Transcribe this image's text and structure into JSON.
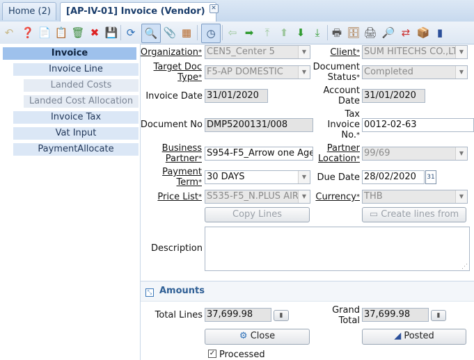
{
  "tabs": {
    "home": "Home (2)",
    "active": "[AP-IV-01] Invoice (Vendor)"
  },
  "toolbar": {
    "icons": [
      "undo-icon",
      "help-icon",
      "new-icon",
      "copy-icon",
      "delete-selection-icon",
      "delete-icon",
      "save-icon",
      "refresh-icon",
      "find-icon",
      "attachment-icon",
      "grid-toggle-icon",
      "history-icon",
      "parent-icon",
      "detail-icon",
      "first-record-icon",
      "previous-record-icon",
      "next-record-icon",
      "last-record-icon",
      "report-icon",
      "archive-icon",
      "print-icon",
      "zoom-across-icon",
      "requests-icon",
      "product-info-icon",
      "active-workflows-icon"
    ]
  },
  "tree": [
    {
      "label": "Invoice",
      "state": "selected"
    },
    {
      "label": "Invoice Line",
      "state": "normal"
    },
    {
      "label": "Landed Costs",
      "state": "disabled"
    },
    {
      "label": "Landed Cost Allocation",
      "state": "disabled"
    },
    {
      "label": "Invoice Tax",
      "state": "normal"
    },
    {
      "label": "Vat Input",
      "state": "normal"
    },
    {
      "label": "PaymentAllocate",
      "state": "normal"
    }
  ],
  "form": {
    "organization": {
      "label": "Organization",
      "value": "CEN5_Center 5"
    },
    "client": {
      "label": "Client",
      "value": "SUM HITECHS CO.,LTD"
    },
    "target_doc_type": {
      "label1": "Target Doc",
      "label2": "Type",
      "value": "F5-AP DOMESTIC"
    },
    "document_status": {
      "label1": "Document",
      "label2": "Status",
      "value": "Completed"
    },
    "invoice_date": {
      "label": "Invoice Date",
      "value": "31/01/2020"
    },
    "account_date": {
      "label1": "Account",
      "label2": "Date",
      "value": "31/01/2020"
    },
    "document_no": {
      "label": "Document No",
      "value": "DMP5200131/008"
    },
    "tax_invoice_no": {
      "label1": "Tax",
      "label2": "Invoice",
      "label3": "No.",
      "value": "0012-02-63"
    },
    "business_partner": {
      "label1": "Business",
      "label2": "Partner",
      "value": "S954-F5_Arrow one Age"
    },
    "partner_location": {
      "label1": "Partner",
      "label2": "Location",
      "value": "99/69"
    },
    "payment_term": {
      "label1": "Payment",
      "label2": "Term",
      "value": "30 DAYS"
    },
    "due_date": {
      "label": "Due Date",
      "value": "28/02/2020"
    },
    "price_list": {
      "label": "Price List",
      "value": "S535-F5_N.PLUS AIR"
    },
    "currency": {
      "label": "Currency",
      "value": "THB"
    },
    "copy_lines": "Copy Lines",
    "create_lines_from": "Create lines from",
    "description": {
      "label": "Description",
      "value": ""
    }
  },
  "amounts": {
    "title": "Amounts",
    "total_lines": {
      "label": "Total Lines",
      "value": "37,699.98"
    },
    "grand_total": {
      "label1": "Grand",
      "label2": "Total",
      "value": "37,699.98"
    },
    "close": "Close",
    "posted": "Posted",
    "processed": "Processed"
  }
}
